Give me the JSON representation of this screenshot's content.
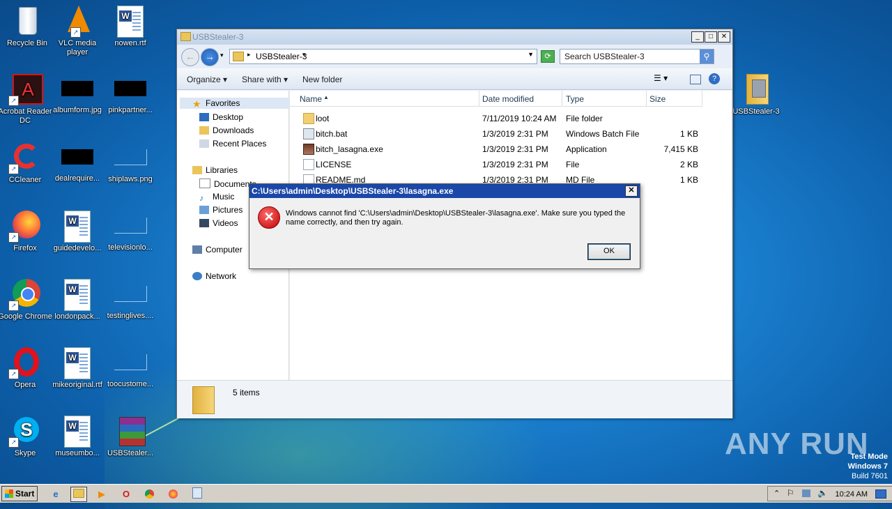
{
  "desktop": {
    "icons": [
      {
        "label": "Recycle Bin"
      },
      {
        "label": "VLC media player"
      },
      {
        "label": "nowen.rtf"
      },
      {
        "label": "Acrobat Reader DC"
      },
      {
        "label": "albumform.jpg"
      },
      {
        "label": "pinkpartner..."
      },
      {
        "label": "CCleaner"
      },
      {
        "label": "dealrequire..."
      },
      {
        "label": "shiplaws.png"
      },
      {
        "label": "Firefox"
      },
      {
        "label": "guidedevelo..."
      },
      {
        "label": "televisionlo..."
      },
      {
        "label": "Google Chrome"
      },
      {
        "label": "londonpack..."
      },
      {
        "label": "testinglives...."
      },
      {
        "label": "Opera"
      },
      {
        "label": "mikeoriginal.rtf"
      },
      {
        "label": "toocustome..."
      },
      {
        "label": "Skype"
      },
      {
        "label": "museumbo..."
      },
      {
        "label": "USBStealer..."
      },
      {
        "label": "USBStealer-3"
      }
    ]
  },
  "explorer": {
    "title": "USBStealer-3",
    "address": "USBStealer-3",
    "search_placeholder": "Search USBStealer-3",
    "toolbar": {
      "organize": "Organize",
      "share_with": "Share with",
      "new_folder": "New folder"
    },
    "nav": {
      "favorites": "Favorites",
      "desktop": "Desktop",
      "downloads": "Downloads",
      "recent": "Recent Places",
      "libraries": "Libraries",
      "documents": "Documents",
      "music": "Music",
      "pictures": "Pictures",
      "videos": "Videos",
      "computer": "Computer",
      "network": "Network"
    },
    "columns": {
      "name": "Name",
      "date": "Date modified",
      "type": "Type",
      "size": "Size"
    },
    "files": [
      {
        "name": "loot",
        "date": "7/11/2019 10:24 AM",
        "type": "File folder",
        "size": ""
      },
      {
        "name": "bitch.bat",
        "date": "1/3/2019 2:31 PM",
        "type": "Windows Batch File",
        "size": "1 KB"
      },
      {
        "name": "bitch_lasagna.exe",
        "date": "1/3/2019 2:31 PM",
        "type": "Application",
        "size": "7,415 KB"
      },
      {
        "name": "LICENSE",
        "date": "1/3/2019 2:31 PM",
        "type": "File",
        "size": "2 KB"
      },
      {
        "name": "README.md",
        "date": "1/3/2019 2:31 PM",
        "type": "MD File",
        "size": "1 KB"
      }
    ],
    "status": "5 items"
  },
  "dialog": {
    "title": "C:\\Users\\admin\\Desktop\\USBStealer-3\\lasagna.exe",
    "message": "Windows cannot find 'C:\\Users\\admin\\Desktop\\USBStealer-3\\lasagna.exe'. Make sure you typed the name correctly, and then try again.",
    "ok": "OK"
  },
  "taskbar": {
    "start": "Start",
    "clock": "10:24 AM"
  },
  "watermark": "ANY RUN",
  "testmode": {
    "line1": "Test Mode",
    "line2": "Windows 7",
    "line3": "Build 7601"
  }
}
